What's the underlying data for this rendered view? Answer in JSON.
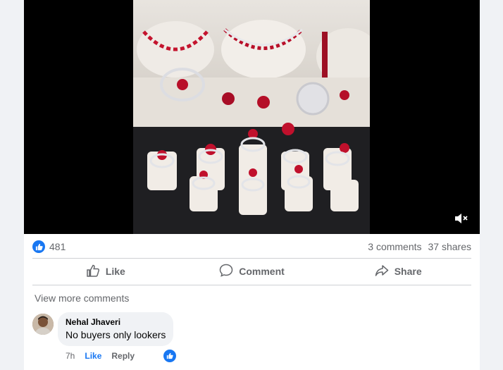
{
  "post": {
    "reactions_count": "481",
    "comments_count": "3 comments",
    "shares_count": "37 shares"
  },
  "actions": {
    "like_label": "Like",
    "comment_label": "Comment",
    "share_label": "Share"
  },
  "comments": {
    "view_more_label": "View more comments",
    "items": [
      {
        "author": "Nehal Jhaveri",
        "text": "No buyers only lookers",
        "time": "7h",
        "like_label": "Like",
        "reply_label": "Reply"
      }
    ]
  },
  "icons": {
    "mute": "mute-icon",
    "like": "thumbs-up-icon",
    "comment": "comment-icon",
    "share": "share-icon"
  },
  "colors": {
    "accent": "#1877f2",
    "text_secondary": "#65676b",
    "video_bg": "#000000"
  }
}
